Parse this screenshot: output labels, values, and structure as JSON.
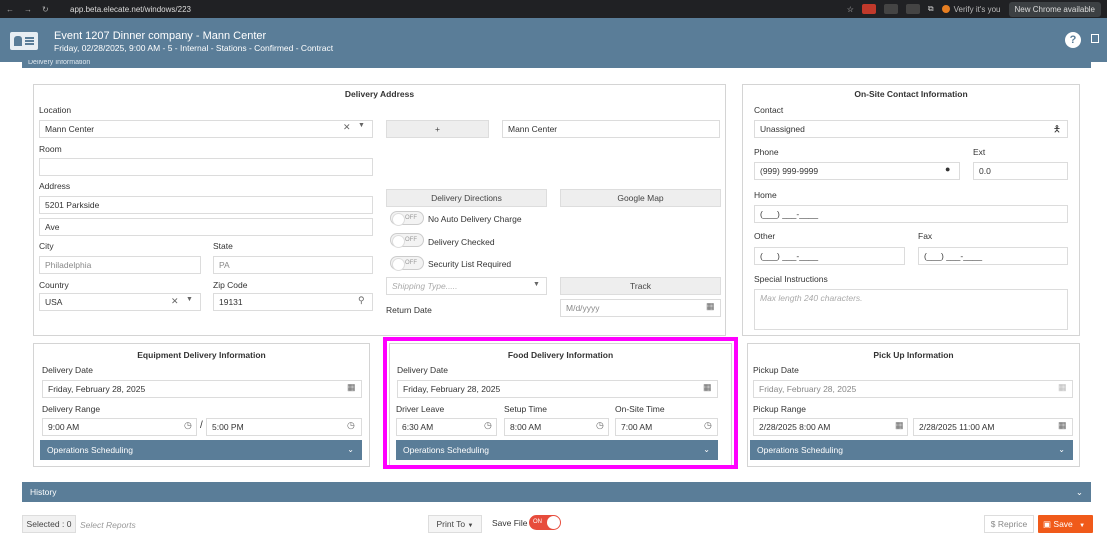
{
  "browser": {
    "url": "app.beta.elecate.net/windows/223",
    "verify": "Verify it's you",
    "new_chrome": "New Chrome available"
  },
  "header": {
    "title": "Event 1207 Dinner company - Mann Center",
    "subtitle": "Friday, 02/28/2025, 9:00 AM - 5 - Internal - Stations - Confirmed - Contract"
  },
  "section_label": "Delivery Information",
  "delivery_address": {
    "title": "Delivery Address",
    "location_label": "Location",
    "location_value": "Mann Center",
    "plus_label": "+",
    "location_name": "Mann Center",
    "room_label": "Room",
    "room_value": "",
    "address_label": "Address",
    "address1": "5201 Parkside",
    "address2": "Ave",
    "city_label": "City",
    "city_value": "Philadelphia",
    "state_label": "State",
    "state_value": "PA",
    "country_label": "Country",
    "country_value": "USA",
    "zip_label": "Zip Code",
    "zip_value": "19131",
    "directions_btn": "Delivery Directions",
    "map_btn": "Google Map",
    "toggle_off": "OFF",
    "toggle1": "No Auto Delivery Charge",
    "toggle2": "Delivery Checked",
    "toggle3": "Security List Required",
    "shipping_placeholder": "Shipping Type.....",
    "track_btn": "Track",
    "return_label": "Return Date",
    "return_placeholder": "M/d/yyyy"
  },
  "contact": {
    "title": "On-Site Contact Information",
    "contact_label": "Contact",
    "contact_value": "Unassigned",
    "phone_label": "Phone",
    "phone_value": "(999) 999-9999",
    "ext_label": "Ext",
    "ext_value": "0.0",
    "home_label": "Home",
    "home_value": "(___) ___-____",
    "other_label": "Other",
    "other_value": "(___) ___-____",
    "fax_label": "Fax",
    "fax_value": "(___) ___-____",
    "special_label": "Special Instructions",
    "special_placeholder": "Max length 240 characters."
  },
  "equipment": {
    "title": "Equipment Delivery Information",
    "date_label": "Delivery Date",
    "date_value": "Friday, February 28, 2025",
    "range_label": "Delivery Range",
    "range_from": "9:00 AM",
    "range_sep": "/",
    "range_to": "5:00 PM",
    "ops": "Operations Scheduling"
  },
  "food": {
    "title": "Food Delivery Information",
    "date_label": "Delivery Date",
    "date_value": "Friday, February 28, 2025",
    "leave_label": "Driver Leave",
    "leave_value": "6:30 AM",
    "setup_label": "Setup Time",
    "setup_value": "8:00 AM",
    "onsite_label": "On-Site Time",
    "onsite_value": "7:00 AM",
    "ops": "Operations Scheduling"
  },
  "pickup": {
    "title": "Pick Up Information",
    "date_label": "Pickup Date",
    "date_value": "Friday, February 28, 2025",
    "range_label": "Pickup Range",
    "range_from": "2/28/2025 8:00 AM",
    "range_to": "2/28/2025 11:00 AM",
    "ops": "Operations Scheduling"
  },
  "history": "History",
  "footer": {
    "selected": "Selected : 0",
    "select_reports": "Select Reports",
    "print_to": "Print To",
    "save_file": "Save File",
    "on": "ON",
    "reprice": "$ Reprice",
    "save": "Save"
  }
}
